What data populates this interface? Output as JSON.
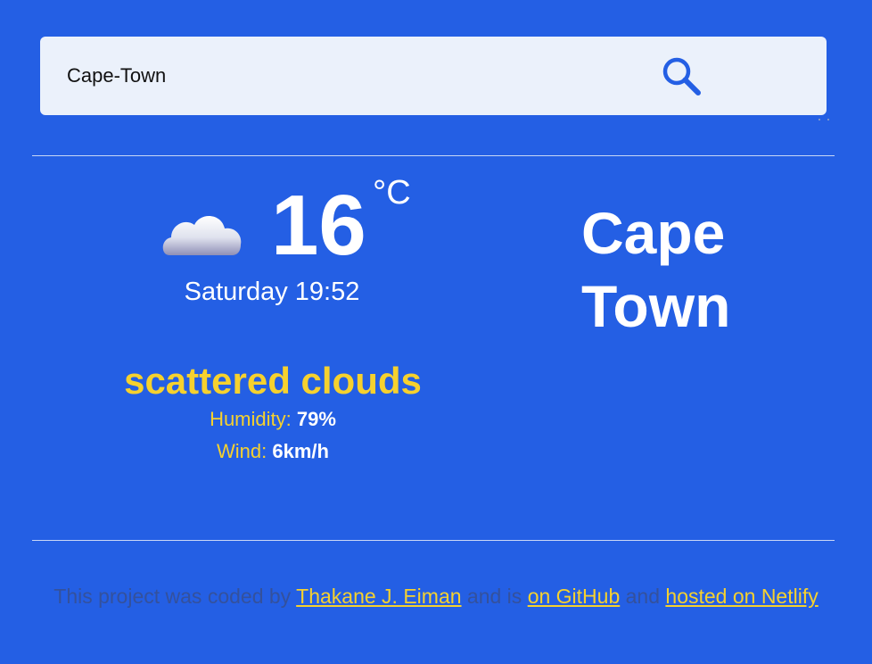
{
  "search": {
    "value": "Cape-Town",
    "icon": "search-icon",
    "location_icon": "current-location-icon"
  },
  "weather": {
    "icon": "cloud-icon",
    "temperature": "16",
    "unit": "°C",
    "datetime": "Saturday 19:52",
    "city_line_1": "Cape",
    "city_line_2": "Town",
    "description": "scattered clouds",
    "humidity_label": "Humidity:",
    "humidity_value": "79%",
    "wind_label": "Wind:",
    "wind_value": "6km/h"
  },
  "footer": {
    "text_1": "This project was coded by",
    "author_link": "Thakane J. Eiman",
    "text_2": "and is",
    "github_link": "on GitHub",
    "text_3": "and",
    "netlify_link": "hosted on Netlify"
  },
  "colors": {
    "background": "#245fe4",
    "search_bar": "#ebf1fb",
    "accent_yellow": "#f6d12e",
    "footer_text": "#34519c",
    "text_white": "#ffffff"
  }
}
